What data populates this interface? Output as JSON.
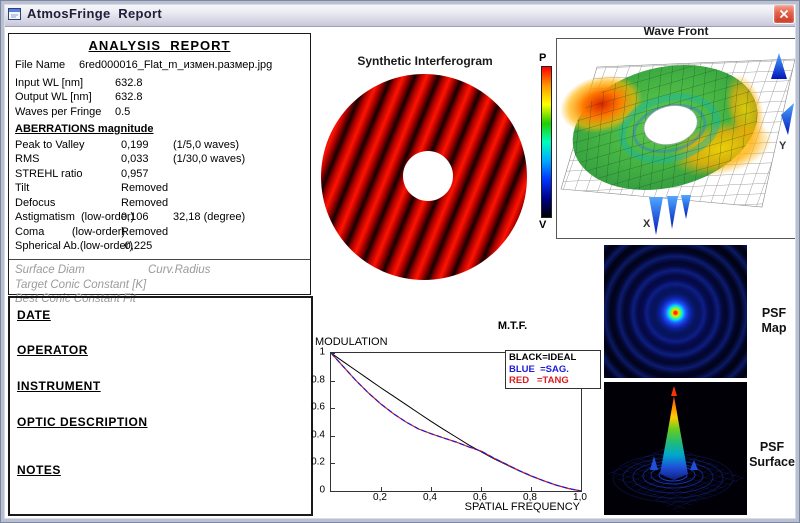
{
  "window": {
    "title": "AtmosFringe  Report"
  },
  "report": {
    "header": "ANALYSIS  REPORT",
    "file_label": "File Name",
    "file_value": "6red000016_Flat_m_измен.размер.jpg",
    "params": [
      {
        "label": "Input  WL [nm]",
        "value": "632.8"
      },
      {
        "label": "Output WL [nm]",
        "value": "632.8"
      },
      {
        "label": "Waves per Fringe",
        "value": "0.5"
      }
    ],
    "aberrations_header": "ABERRATIONS magnitude",
    "aberrations": [
      {
        "label": "Peak to Valley",
        "value": "0,199",
        "extra": "(1/5,0 waves)"
      },
      {
        "label": "RMS",
        "value": "0,033",
        "extra": "(1/30,0 waves)"
      },
      {
        "label": "STREHL ratio",
        "value": "0,957",
        "extra": ""
      },
      {
        "label": "Tilt",
        "value": "Removed",
        "extra": ""
      },
      {
        "label": "Defocus",
        "value": "Removed",
        "extra": ""
      },
      {
        "label": "Astigmatism  (low-order)",
        "value": "0,106",
        "extra": "32,18 (degree)"
      },
      {
        "label": "Coma         (low-order)",
        "value": "Removed",
        "extra": ""
      },
      {
        "label": "Spherical Ab.(low-order)",
        "value": "-0,225",
        "extra": ""
      }
    ],
    "conic_lines": [
      {
        "left": "Surface Diam",
        "right": "Curv.Radius"
      },
      {
        "left": "Target Conic Constant [K]",
        "right": ""
      },
      {
        "left": "Best Conic Constant Fit",
        "right": ""
      }
    ],
    "form_fields": [
      "DATE",
      "OPERATOR",
      "INSTRUMENT",
      "OPTIC DESCRIPTION",
      "NOTES"
    ]
  },
  "interferogram": {
    "title": "Synthetic Interferogram"
  },
  "wavefront": {
    "title": "Wave Front",
    "peak_label": "P",
    "valley_label": "V",
    "x_axis": "X",
    "y_axis": "Y",
    "colorbar": [
      "#ff0000",
      "#ff9900",
      "#ffff00",
      "#22cc00",
      "#00ffbb",
      "#00aaff",
      "#0033ff",
      "#000088",
      "#000000"
    ]
  },
  "psf": {
    "map_line1": "PSF",
    "map_line2": "Map",
    "surface_line1": "PSF",
    "surface_line2": "Surface"
  },
  "chart_data": {
    "type": "line",
    "title": "M.T.F.",
    "xlabel": "SPATIAL FREQUENCY",
    "ylabel": "MODULATION",
    "xlim": [
      0,
      1
    ],
    "ylim": [
      0,
      1
    ],
    "grid": false,
    "legend_position": "top-right",
    "legend": [
      {
        "label": "BLACK=IDEAL",
        "color": "#000000"
      },
      {
        "label": "BLUE  =SAG.",
        "color": "#1c1cd8"
      },
      {
        "label": "RED   =TANG",
        "color": "#d81c1c"
      }
    ],
    "x_ticks": [
      {
        "v": 0.2,
        "label": "0,2"
      },
      {
        "v": 0.4,
        "label": "0,4"
      },
      {
        "v": 0.6,
        "label": "0,6"
      },
      {
        "v": 0.8,
        "label": "0,8"
      },
      {
        "v": 1.0,
        "label": "1,0"
      }
    ],
    "y_ticks": [
      {
        "v": 1,
        "label": "1"
      },
      {
        "v": 0.8,
        "label": "0.8"
      },
      {
        "v": 0.6,
        "label": "0.6"
      },
      {
        "v": 0.4,
        "label": "0.4"
      },
      {
        "v": 0.2,
        "label": "0.2"
      },
      {
        "v": 0,
        "label": "0"
      }
    ],
    "x": [
      0,
      0.05,
      0.1,
      0.15,
      0.2,
      0.25,
      0.3,
      0.35,
      0.4,
      0.45,
      0.5,
      0.55,
      0.6,
      0.65,
      0.7,
      0.75,
      0.8,
      0.85,
      0.9,
      0.95,
      1.0
    ],
    "series": [
      {
        "name": "IDEAL",
        "color": "#000000",
        "dash": "",
        "values": [
          1,
          0.936,
          0.873,
          0.81,
          0.747,
          0.687,
          0.626,
          0.565,
          0.505,
          0.447,
          0.391,
          0.335,
          0.285,
          0.235,
          0.191,
          0.148,
          0.109,
          0.074,
          0.043,
          0.018,
          0
        ]
      },
      {
        "name": "TANG",
        "color": "#d81c1c",
        "dash": "",
        "values": [
          1,
          0.9,
          0.8,
          0.71,
          0.63,
          0.56,
          0.5,
          0.45,
          0.415,
          0.385,
          0.355,
          0.32,
          0.29,
          0.24,
          0.195,
          0.15,
          0.11,
          0.075,
          0.043,
          0.018,
          0
        ]
      },
      {
        "name": "SAG",
        "color": "#1c1cd8",
        "dash": "5 3",
        "values": [
          1,
          0.9,
          0.8,
          0.71,
          0.63,
          0.56,
          0.5,
          0.45,
          0.415,
          0.385,
          0.355,
          0.32,
          0.29,
          0.24,
          0.195,
          0.15,
          0.11,
          0.075,
          0.043,
          0.018,
          0
        ]
      }
    ]
  }
}
